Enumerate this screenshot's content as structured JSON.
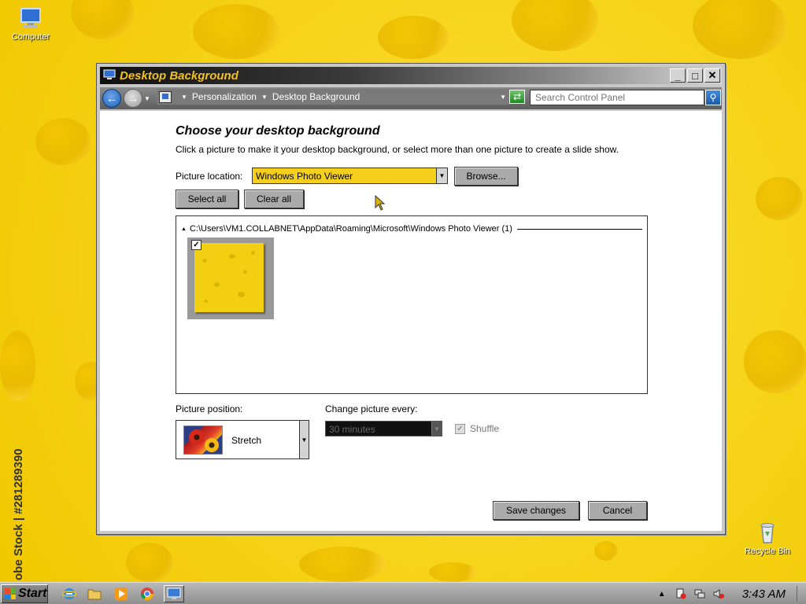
{
  "desktop": {
    "icons": [
      {
        "label": "Computer",
        "icon": "computer-icon"
      },
      {
        "label": "Recycle Bin",
        "icon": "recycle-bin-icon"
      }
    ],
    "watermark": "obe Stock | #281289390"
  },
  "window": {
    "title": "Desktop Background",
    "buttons": {
      "minimize": "_",
      "maximize": "□",
      "close": "✕"
    }
  },
  "addressbar": {
    "crumbs": [
      "Personalization",
      "Desktop Background"
    ],
    "search_placeholder": "Search Control Panel"
  },
  "main": {
    "heading": "Choose your desktop background",
    "description": "Click a picture to make it your desktop background, or select more than one picture to create a slide show.",
    "picture_location_label": "Picture location:",
    "picture_location_value": "Windows Photo Viewer",
    "browse_label": "Browse...",
    "select_all_label": "Select all",
    "clear_all_label": "Clear all",
    "folder_path": "C:\\Users\\VM1.COLLABNET\\AppData\\Roaming\\Microsoft\\Windows Photo Viewer (1)",
    "picture_checked": true,
    "picture_position_label": "Picture position:",
    "picture_position_value": "Stretch",
    "change_every_label": "Change picture every:",
    "change_every_value": "30 minutes",
    "shuffle_label": "Shuffle",
    "save_label": "Save changes",
    "cancel_label": "Cancel"
  },
  "taskbar": {
    "start_label": "Start",
    "apps": [
      "internet-explorer-icon",
      "folder-icon",
      "media-player-icon",
      "chrome-icon",
      "control-panel-icon"
    ],
    "clock": "3:43 AM"
  },
  "colors": {
    "desktop": "#f7d51c",
    "title_text": "#f2c21b",
    "location_highlight": "#f4cf1d"
  }
}
